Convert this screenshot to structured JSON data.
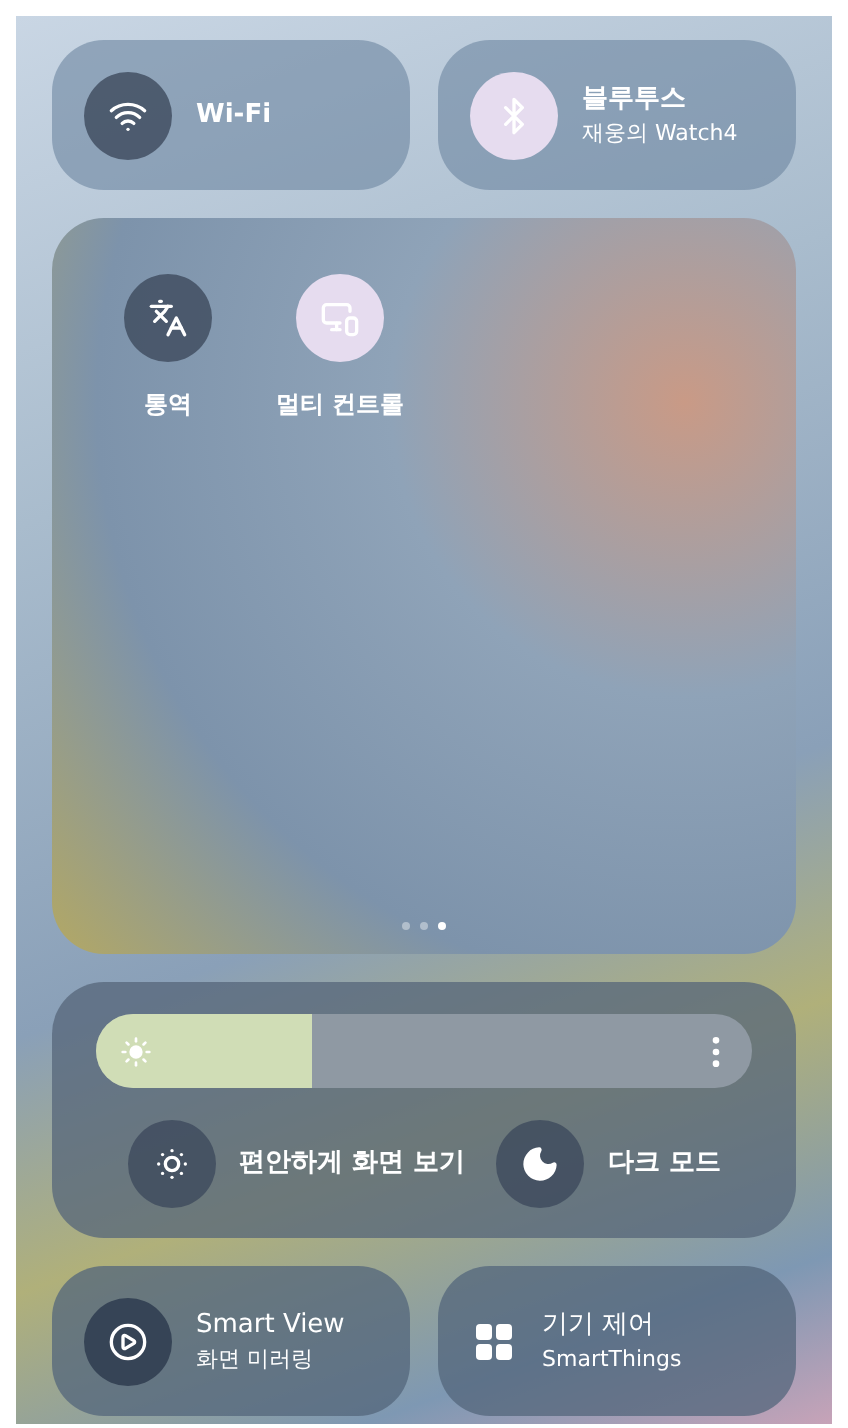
{
  "top_tiles": [
    {
      "kind": "wifi",
      "title": "Wi-Fi",
      "on": false
    },
    {
      "kind": "bluetooth",
      "title": "블루투스",
      "subtitle": "재웅의 Watch4",
      "on": true
    }
  ],
  "quick_toggles": [
    {
      "kind": "translate",
      "label": "통역",
      "on": false
    },
    {
      "kind": "multi-control",
      "label": "멀티 컨트롤",
      "on": true
    }
  ],
  "page_dots": [
    {
      "selected": false
    },
    {
      "selected": false
    },
    {
      "selected": true
    }
  ],
  "brightness": {
    "level": 0.33
  },
  "display_toggles": [
    {
      "kind": "eye-comfort",
      "label": "편안하게 화면 보기",
      "on": false
    },
    {
      "kind": "dark-mode",
      "label": "다크 모드",
      "on": false
    }
  ],
  "bottom_tiles": [
    {
      "kind": "smart-view",
      "title": "Smart View",
      "subtitle": "화면 미러링"
    },
    {
      "kind": "device-control",
      "title": "기기 제어",
      "subtitle": "SmartThings"
    }
  ]
}
